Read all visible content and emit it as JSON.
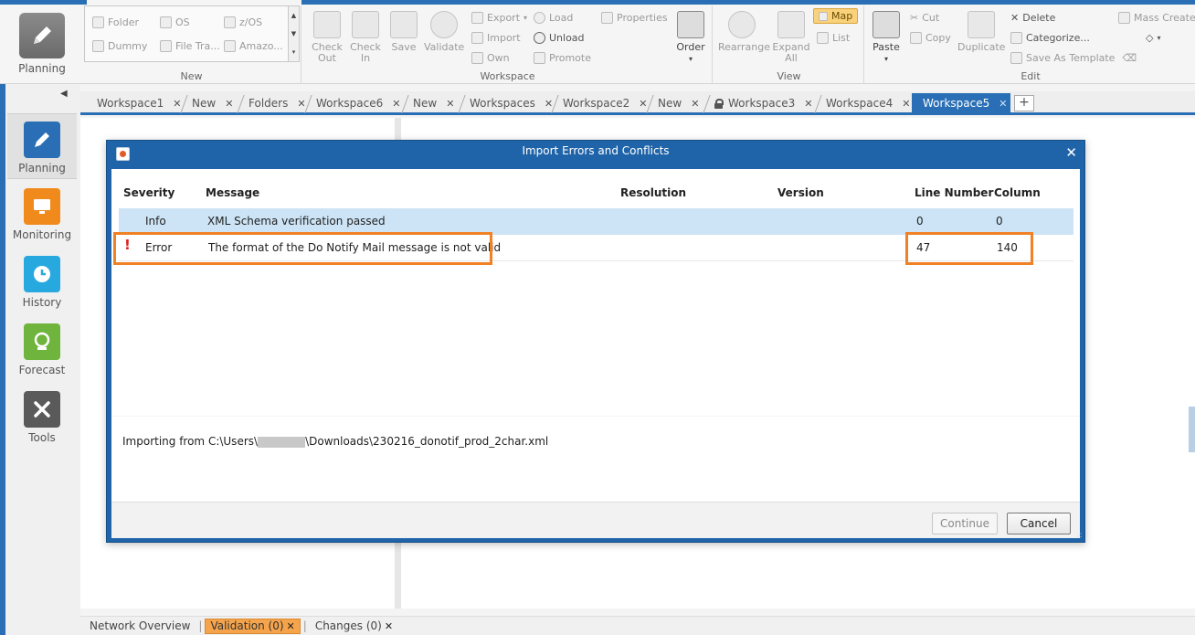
{
  "ribbon": {
    "app_button_label": "Planning",
    "groups": {
      "new": {
        "label": "New",
        "gallery": [
          "Folder",
          "OS",
          "z/OS",
          "Dummy",
          "File Tra...",
          "Amazo..."
        ]
      },
      "workspace": {
        "label": "Workspace",
        "check_out": "Check Out",
        "check_in": "Check In",
        "save": "Save",
        "validate": "Validate",
        "export": "Export",
        "import": "Import",
        "own": "Own",
        "load": "Load",
        "unload": "Unload",
        "promote": "Promote",
        "properties": "Properties",
        "order": "Order"
      },
      "view": {
        "label": "View",
        "rearrange": "Rearrange",
        "expand_all": "Expand All",
        "map": "Map",
        "list": "List"
      },
      "edit": {
        "label": "Edit",
        "paste": "Paste",
        "cut": "Cut",
        "copy": "Copy",
        "duplicate": "Duplicate",
        "delete": "Delete",
        "categorize": "Categorize...",
        "save_as_template": "Save As Template",
        "mass_create": "Mass Create"
      }
    }
  },
  "tabs": [
    {
      "label": "Workspace1"
    },
    {
      "label": "New"
    },
    {
      "label": "Folders"
    },
    {
      "label": "Workspace6"
    },
    {
      "label": "New"
    },
    {
      "label": "Workspaces"
    },
    {
      "label": "Workspace2"
    },
    {
      "label": "New"
    },
    {
      "label": "Workspace3",
      "locked": true
    },
    {
      "label": "Workspace4"
    },
    {
      "label": "Workspace5",
      "active": true
    }
  ],
  "leftnav": [
    {
      "label": "Planning",
      "icon": "pencil-icon",
      "selected": true
    },
    {
      "label": "Monitoring",
      "icon": "monitor-icon"
    },
    {
      "label": "History",
      "icon": "history-clock-icon"
    },
    {
      "label": "Forecast",
      "icon": "forecast-icon"
    },
    {
      "label": "Tools",
      "icon": "tools-icon"
    }
  ],
  "bottom_bar": {
    "network_overview": "Network Overview",
    "validation": "Validation (0)",
    "changes": "Changes (0)"
  },
  "dialog": {
    "title": "Import Errors and Conflicts",
    "columns": [
      "Severity",
      "Message",
      "Resolution",
      "Version",
      "Line Number",
      "Column"
    ],
    "rows": [
      {
        "severity": "Info",
        "message": "XML Schema verification passed",
        "resolution": "",
        "version": "",
        "line": "0",
        "column": "0"
      },
      {
        "severity": "Error",
        "message": "The format of the Do Notify Mail message is not valid",
        "resolution": "",
        "version": "",
        "line": "47",
        "column": "140"
      }
    ],
    "import_prefix": "Importing from C:\\Users\\",
    "import_suffix": "\\Downloads\\230216_donotif_prod_2char.xml",
    "continue_label": "Continue",
    "cancel_label": "Cancel"
  },
  "colors": {
    "accent_blue": "#2a6fb5",
    "highlight_orange": "#f08125",
    "error_red": "#e0201f",
    "selected_row": "#cce4f5"
  }
}
